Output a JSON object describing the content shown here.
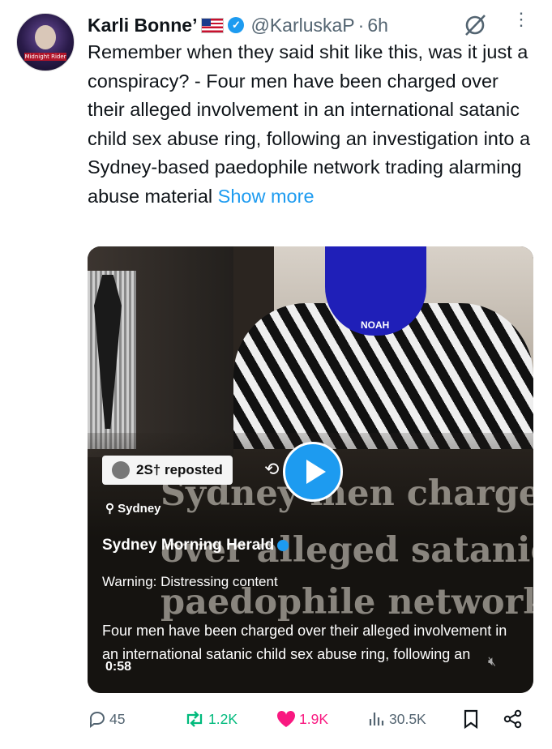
{
  "tweet": {
    "display_name": "Karli Bonne’",
    "handle": "@KarluskaP",
    "separator": "·",
    "time": "6h",
    "verified_mark": "✓",
    "avatar_text": "Midnight Rider",
    "text": "Remember when they said shit like this, was it just a conspiracy? - Four men have been charged over their alleged involvement in an international satanic child sex abuse ring, following an investigation into a Sydney-based paedophile network trading alarming abuse material",
    "show_more": "Show more"
  },
  "media": {
    "repost_label": "2S† reposted",
    "location": "Sydney",
    "publisher": "Sydney Morning Herald",
    "warning": "Warning: Distressing content",
    "headline_lines": [
      "Sydney men charged",
      "over alleged satanic",
      "paedophile network"
    ],
    "description": "Four men have been charged over their alleged involvement in an international satanic child sex abuse ring, following an",
    "timer": "0:58",
    "hood_text": "NOAH"
  },
  "actions": {
    "replies": "45",
    "reposts": "1.2K",
    "likes": "1.9K",
    "views": "30.5K"
  },
  "colors": {
    "accent": "#1d9bf0",
    "repost_green": "#00ba7c",
    "like_pink": "#f91880",
    "muted_text": "#536471"
  }
}
